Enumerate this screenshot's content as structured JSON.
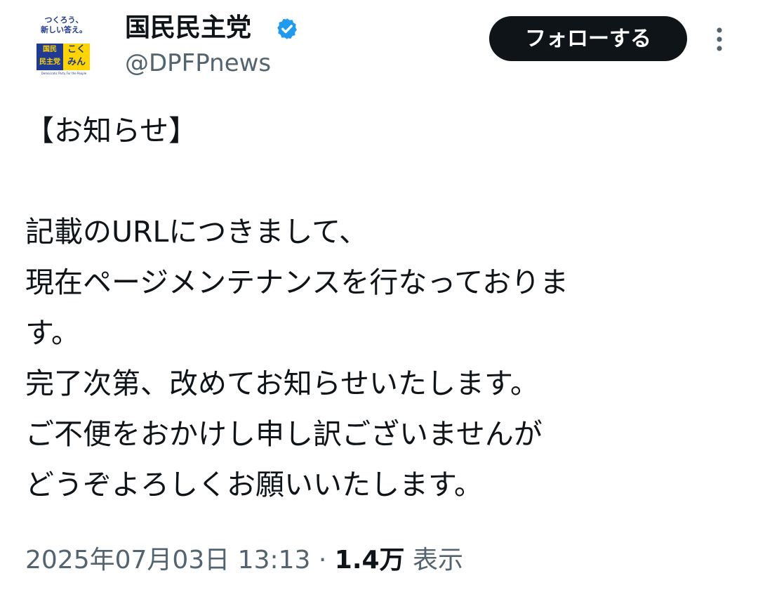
{
  "account": {
    "avatar": {
      "logo_line1": "つくろう、",
      "logo_line2": "新しい答え。",
      "logo_blue_text": "国民\n民主党",
      "logo_yellow_text": "こく\nみん",
      "logo_tagline": "Democratic Party For the People"
    },
    "display_name": "国民民主党",
    "handle": "@DPFPnews",
    "verified": true,
    "colors": {
      "verified_badge": "#1d9bf0",
      "follow_button_bg": "#0f1419"
    }
  },
  "actions": {
    "follow_label": "フォローする",
    "more_icon": "more-vertical-icon"
  },
  "tweet": {
    "lines": [
      "【お知らせ】",
      "",
      "記載のURLにつきまして、",
      "現在ページメンテナンスを行なっておりま",
      "す。",
      "完了次第、改めてお知らせいたします。",
      "ご不便をおかけし申し訳ございませんが",
      "どうぞよろしくお願いいたします。"
    ]
  },
  "meta": {
    "timestamp": "2025年07月03日 13:13",
    "separator": " · ",
    "views_count": "1.4万",
    "views_label": " 表示"
  }
}
